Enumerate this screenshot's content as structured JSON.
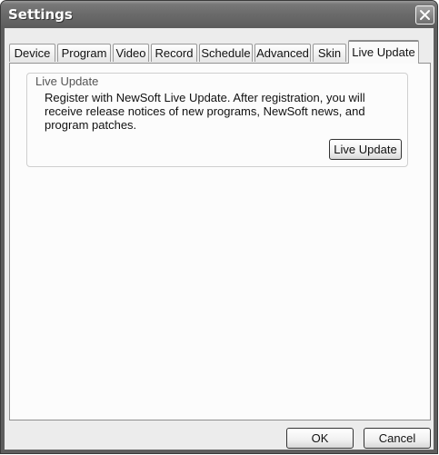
{
  "window": {
    "title": "Settings"
  },
  "tabs": [
    {
      "label": "Device"
    },
    {
      "label": "Program"
    },
    {
      "label": "Video"
    },
    {
      "label": "Record"
    },
    {
      "label": "Schedule"
    },
    {
      "label": "Advanced"
    },
    {
      "label": "Skin"
    },
    {
      "label": "Live Update",
      "active": true
    }
  ],
  "group": {
    "title": "Live Update",
    "description": "Register with NewSoft Live Update. After registration, you will receive release notices of new programs, NewSoft news, and program patches.",
    "button_label": "Live Update"
  },
  "footer": {
    "ok_label": "OK",
    "cancel_label": "Cancel"
  }
}
